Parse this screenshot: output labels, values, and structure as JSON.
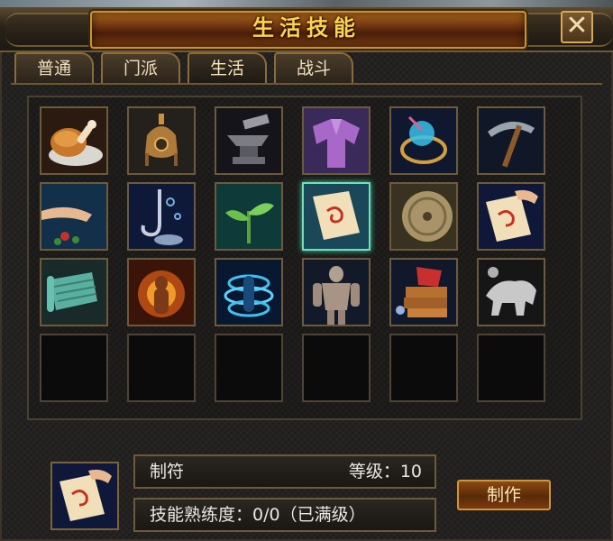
{
  "window": {
    "title": "生活技能",
    "close_symbol": "✕"
  },
  "tabs": [
    {
      "label": "普通",
      "active": false
    },
    {
      "label": "门派",
      "active": false
    },
    {
      "label": "生活",
      "active": true
    },
    {
      "label": "战斗",
      "active": false
    }
  ],
  "skills": [
    {
      "icon": "roast-drumstick-icon"
    },
    {
      "icon": "alchemy-furnace-icon"
    },
    {
      "icon": "anvil-hammer-icon"
    },
    {
      "icon": "tailoring-robe-icon"
    },
    {
      "icon": "jewel-crafting-icon"
    },
    {
      "icon": "pickaxe-icon"
    },
    {
      "icon": "herb-gathering-icon"
    },
    {
      "icon": "fishing-hook-icon"
    },
    {
      "icon": "seedling-icon"
    },
    {
      "icon": "talisman-scroll-icon",
      "selected": true
    },
    {
      "icon": "millstone-icon"
    },
    {
      "icon": "talisman-hand-icon"
    },
    {
      "icon": "jade-scroll-icon"
    },
    {
      "icon": "fire-aura-icon"
    },
    {
      "icon": "water-aura-icon"
    },
    {
      "icon": "muscle-body-icon"
    },
    {
      "icon": "leather-book-icon"
    },
    {
      "icon": "silver-beast-icon"
    }
  ],
  "empty_slots": 6,
  "detail": {
    "icon": "talisman-scroll-icon",
    "name": "制符",
    "level_text": "等级：10",
    "proficiency_text": "技能熟练度：0/0（已满级）",
    "make_button": "制作"
  },
  "colors": {
    "title": "#ffd24a",
    "frame_gold": "#c8923a",
    "selected_border": "#6ee0c0"
  }
}
